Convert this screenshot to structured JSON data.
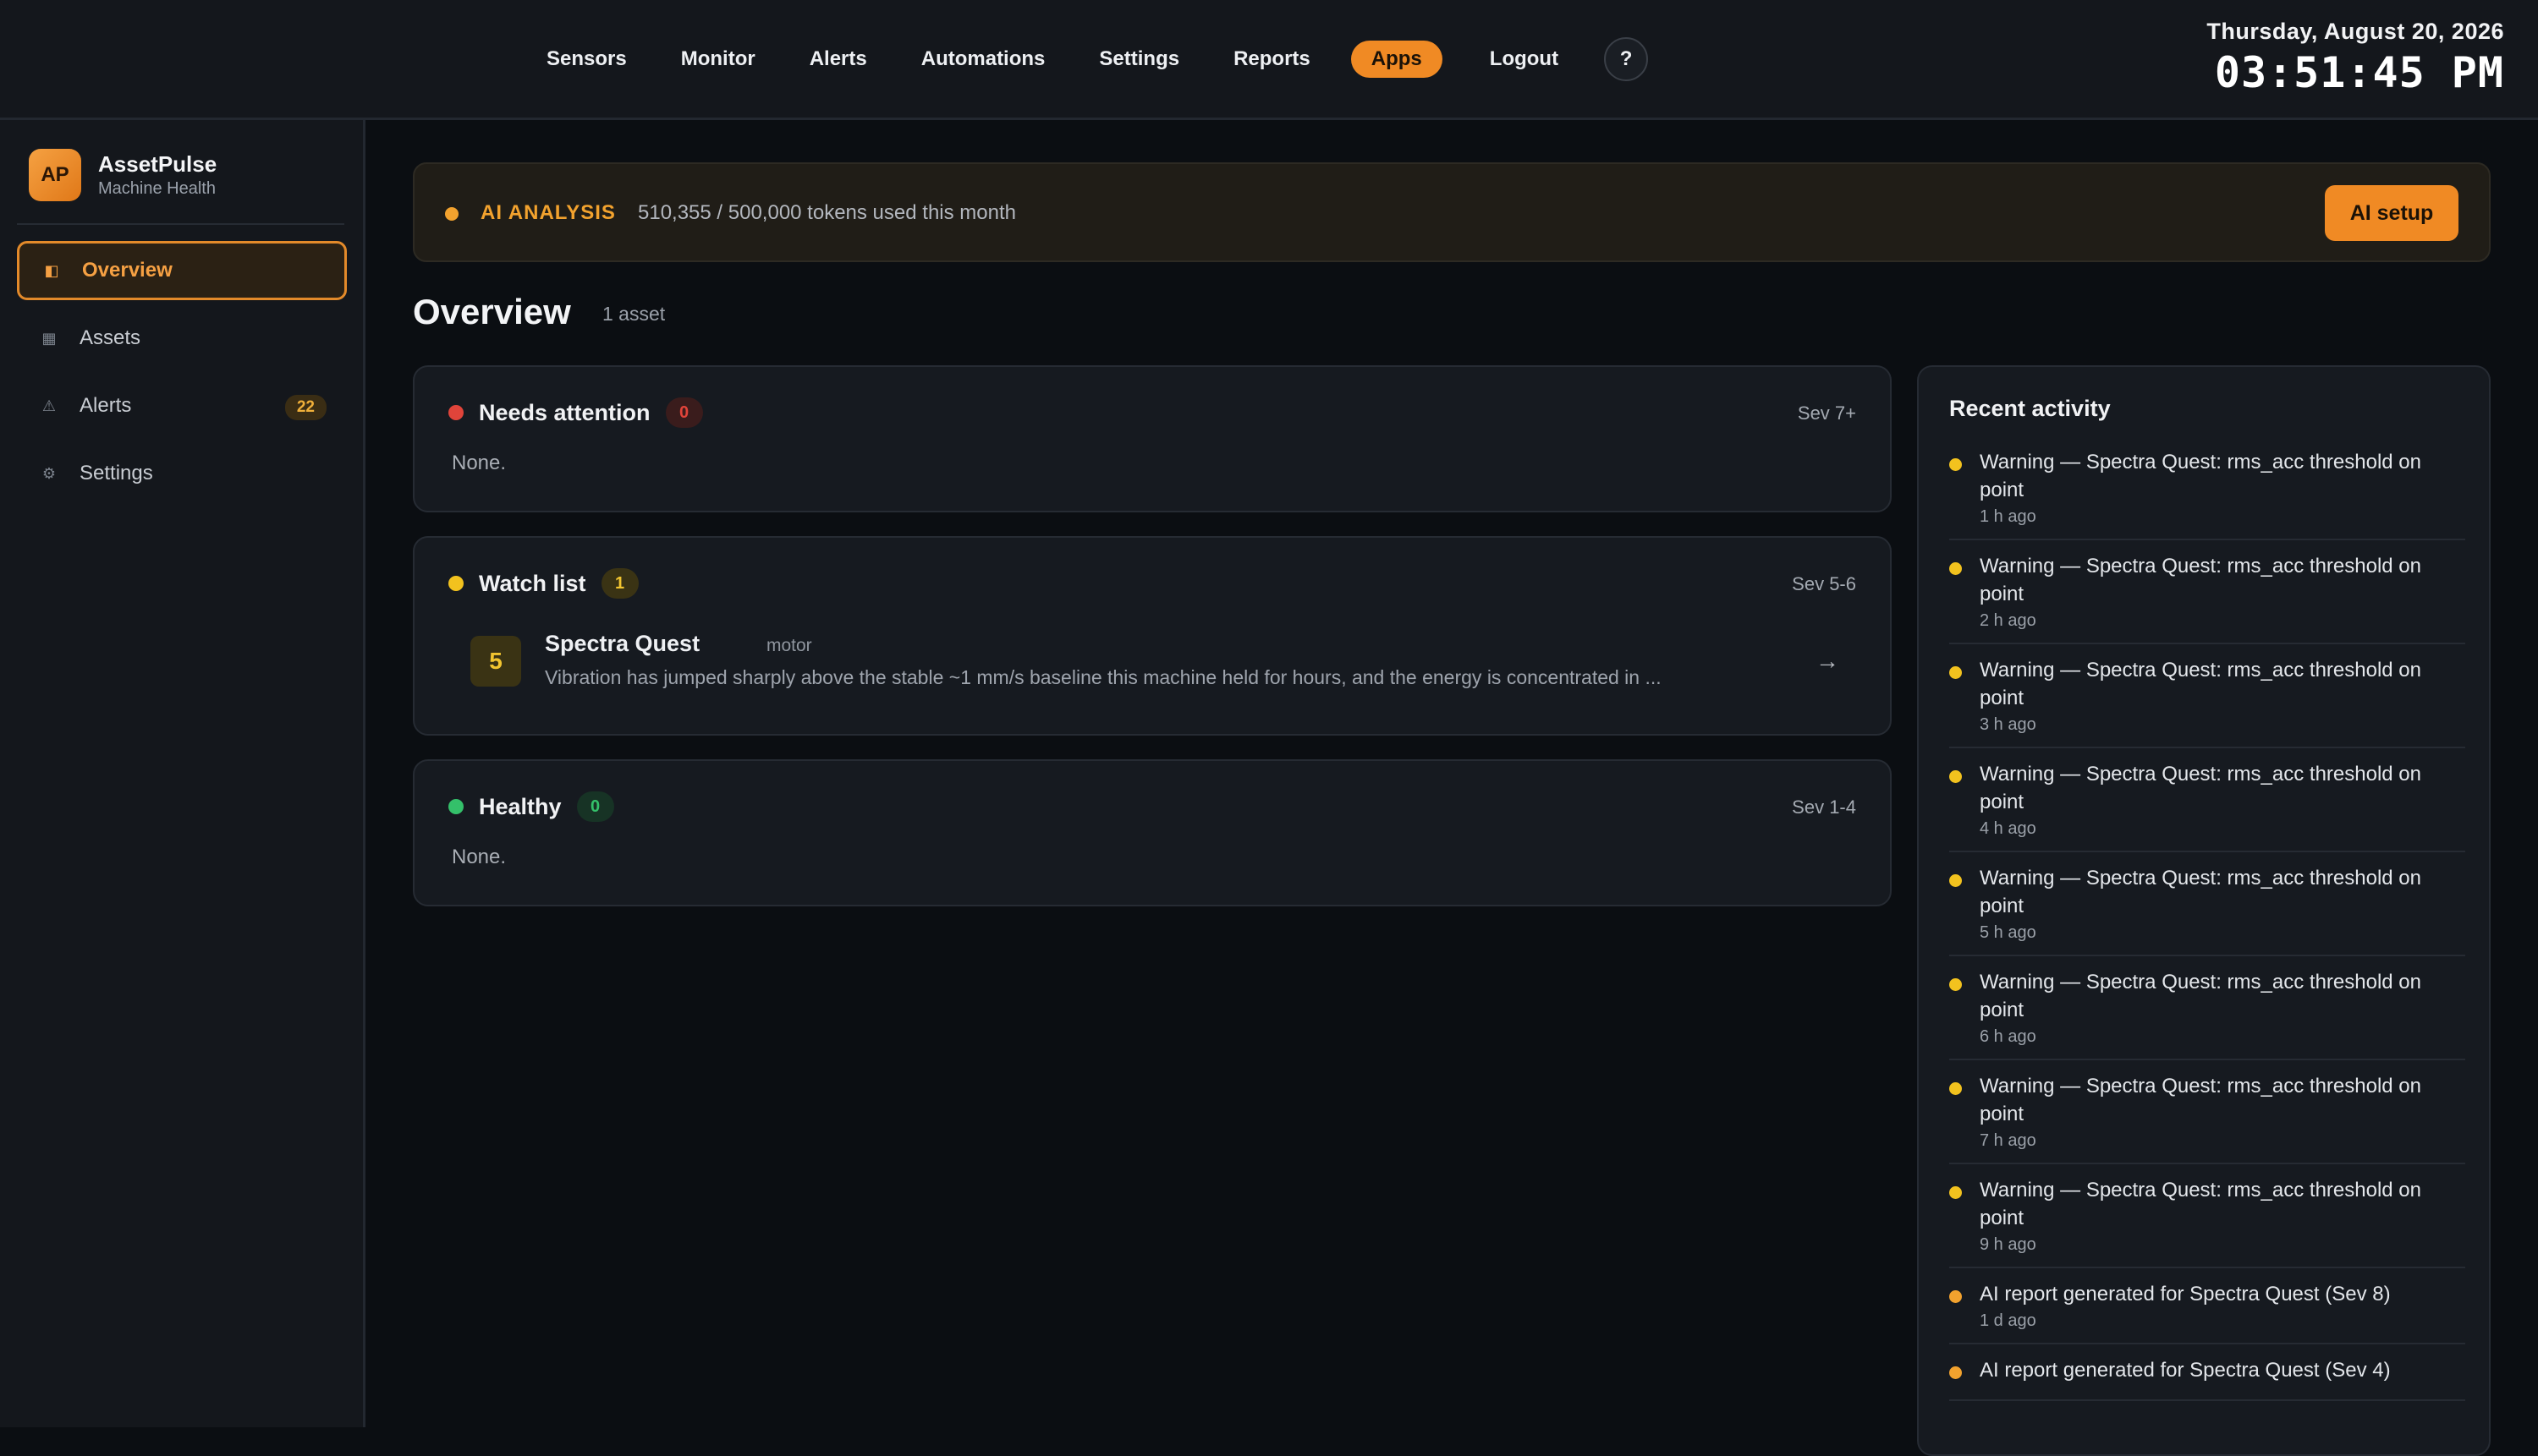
{
  "topnav": {
    "items": [
      "Sensors",
      "Monitor",
      "Alerts",
      "Automations",
      "Settings",
      "Reports",
      "Apps",
      "Logout"
    ],
    "active": "Apps",
    "help_label": "?"
  },
  "clock": {
    "date": "Thursday, August 20, 2026",
    "time": "03:51:45 PM"
  },
  "brand": {
    "logo": "AP",
    "name": "AssetPulse",
    "subtitle": "Machine Health"
  },
  "sidebar": {
    "items": [
      {
        "label": "Overview",
        "icon": "overview-icon",
        "glyph": "◧",
        "active": true
      },
      {
        "label": "Assets",
        "icon": "grid-icon",
        "glyph": "▦"
      },
      {
        "label": "Alerts",
        "icon": "warning-icon",
        "glyph": "⚠",
        "badge": "22"
      },
      {
        "label": "Settings",
        "icon": "gear-icon",
        "glyph": "⚙"
      }
    ]
  },
  "ai_banner": {
    "label": "AI ANALYSIS",
    "usage": "510,355 / 500,000 tokens used this month",
    "button": "AI setup"
  },
  "overview": {
    "title": "Overview",
    "count": "1 asset"
  },
  "groups": {
    "needs_attention": {
      "title": "Needs attention",
      "count": "0",
      "sev": "Sev 7+",
      "empty": "None.",
      "color": "#e0443a"
    },
    "watch_list": {
      "title": "Watch list",
      "count": "1",
      "sev": "Sev 5-6",
      "color": "#f2c21e",
      "assets": [
        {
          "severity": "5",
          "name": "Spectra Quest",
          "type": "motor",
          "description": "Vibration has jumped sharply above the stable ~1 mm/s baseline this machine held for hours, and the energy is concentrated in ...",
          "arrow": "→"
        }
      ]
    },
    "healthy": {
      "title": "Healthy",
      "count": "0",
      "sev": "Sev 1-4",
      "empty": "None.",
      "color": "#34c06a"
    }
  },
  "activity": {
    "title": "Recent activity",
    "items": [
      {
        "text": "Warning — Spectra Quest: rms_acc threshold on point",
        "time": "1 h ago",
        "kind": "warning"
      },
      {
        "text": "Warning — Spectra Quest: rms_acc threshold on point",
        "time": "2 h ago",
        "kind": "warning"
      },
      {
        "text": "Warning — Spectra Quest: rms_acc threshold on point",
        "time": "3 h ago",
        "kind": "warning"
      },
      {
        "text": "Warning — Spectra Quest: rms_acc threshold on point",
        "time": "4 h ago",
        "kind": "warning"
      },
      {
        "text": "Warning — Spectra Quest: rms_acc threshold on point",
        "time": "5 h ago",
        "kind": "warning"
      },
      {
        "text": "Warning — Spectra Quest: rms_acc threshold on point",
        "time": "6 h ago",
        "kind": "warning"
      },
      {
        "text": "Warning — Spectra Quest: rms_acc threshold on point",
        "time": "7 h ago",
        "kind": "warning"
      },
      {
        "text": "Warning — Spectra Quest: rms_acc threshold on point",
        "time": "9 h ago",
        "kind": "warning"
      },
      {
        "text": "AI report generated for Spectra Quest (Sev 8)",
        "time": "1 d ago",
        "kind": "report"
      },
      {
        "text": "AI report generated for Spectra Quest (Sev 4)",
        "time": "",
        "kind": "report"
      }
    ]
  }
}
